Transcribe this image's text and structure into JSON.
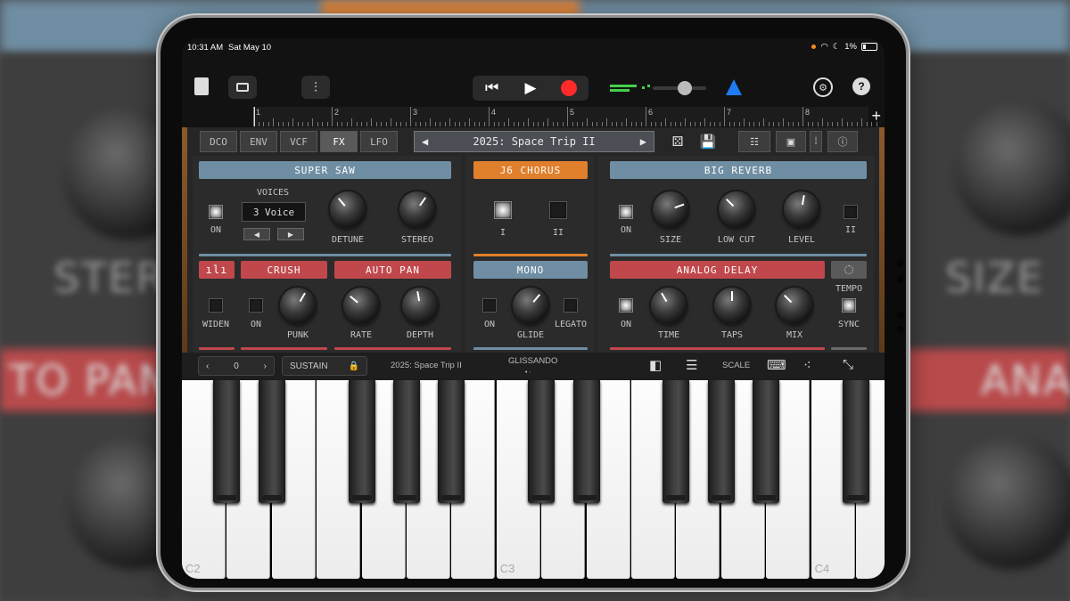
{
  "status": {
    "time": "10:31 AM",
    "date": "Sat May 10",
    "battery": "1%"
  },
  "ruler": {
    "marks": [
      "1",
      "2",
      "3",
      "4",
      "5",
      "6",
      "7",
      "8"
    ]
  },
  "tabs": [
    "DCO",
    "ENV",
    "VCF",
    "FX",
    "LFO"
  ],
  "active_tab": "FX",
  "preset": {
    "name": "2025: Space Trip II",
    "prev_icon": "◀",
    "next_icon": "▶"
  },
  "super_saw": {
    "title": "SUPER SAW",
    "voices_label": "VOICES",
    "voices_value": "3 Voice",
    "on_label": "ON",
    "detune_label": "DETUNE",
    "stereo_label": "STEREO"
  },
  "chorus": {
    "title": "J6 CHORUS",
    "i_label": "I",
    "ii_label": "II"
  },
  "reverb": {
    "title": "BIG REVERB",
    "on_label": "ON",
    "size_label": "SIZE",
    "lowcut_label": "LOW CUT",
    "level_label": "LEVEL",
    "ii_label": "II"
  },
  "crush": {
    "title": "CRUSH",
    "widen_label": "WIDEN",
    "on_label": "ON",
    "punk_label": "PUNK"
  },
  "autopan": {
    "title": "AUTO PAN",
    "rate_label": "RATE",
    "depth_label": "DEPTH"
  },
  "mono": {
    "title": "MONO",
    "on_label": "ON",
    "glide_label": "GLIDE",
    "legato_label": "LEGATO"
  },
  "delay": {
    "title": "ANALOG DELAY",
    "on_label": "ON",
    "time_label": "TIME",
    "taps_label": "TAPS",
    "mix_label": "MIX",
    "tempo_label": "TEMPO",
    "sync_label": "SYNC"
  },
  "keyboard_bar": {
    "octave_value": "0",
    "sustain_label": "SUSTAIN",
    "preset_name": "2025: Space Trip II",
    "glissando_label": "GLISSANDO",
    "scale_label": "SCALE"
  },
  "keys": {
    "c2": "C2",
    "c3": "C3",
    "c4": "C4"
  },
  "colors": {
    "blue": "#6f8ea3",
    "orange": "#e07f2c",
    "red": "#c0484c",
    "record": "#ff2a2a",
    "metronome": "#1e7bf0"
  }
}
